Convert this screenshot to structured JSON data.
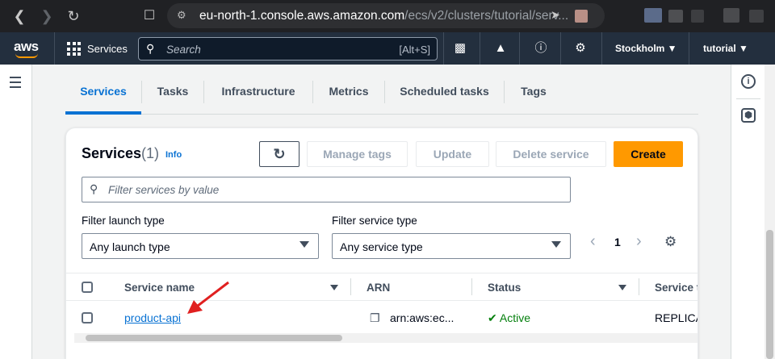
{
  "browser": {
    "url_host": "eu-north-1.console.aws.amazon.com",
    "url_path": "/ecs/v2/clusters/tutorial/serv..."
  },
  "awsbar": {
    "logo": "aws",
    "services_label": "Services",
    "search_placeholder": "Search",
    "search_shortcut": "[Alt+S]",
    "region": "Stockholm ▼",
    "account": "tutorial ▼"
  },
  "tabs": [
    {
      "label": "Services",
      "active": true
    },
    {
      "label": "Tasks"
    },
    {
      "label": "Infrastructure"
    },
    {
      "label": "Metrics"
    },
    {
      "label": "Scheduled tasks"
    },
    {
      "label": "Tags"
    }
  ],
  "panel": {
    "title": "Services",
    "count": "(1)",
    "info": "Info",
    "buttons": {
      "manage_tags": "Manage tags",
      "update": "Update",
      "delete": "Delete service",
      "create": "Create"
    },
    "filter_placeholder": "Filter services by value",
    "launch_type_label": "Filter launch type",
    "launch_type_value": "Any launch type",
    "service_type_label": "Filter service type",
    "service_type_value": "Any service type",
    "page": "1"
  },
  "table": {
    "columns": [
      "Service name",
      "ARN",
      "Status",
      "Service t"
    ],
    "rows": [
      {
        "name": "product-api",
        "arn": "arn:aws:ec...",
        "status": "Active",
        "service_type": "REPLICA"
      }
    ]
  },
  "colors": {
    "accent": "#0972d3",
    "primary_button": "#ff9900",
    "nav_bg": "#232f3e",
    "success": "#037f0c",
    "annotation_arrow": "#e02020"
  }
}
